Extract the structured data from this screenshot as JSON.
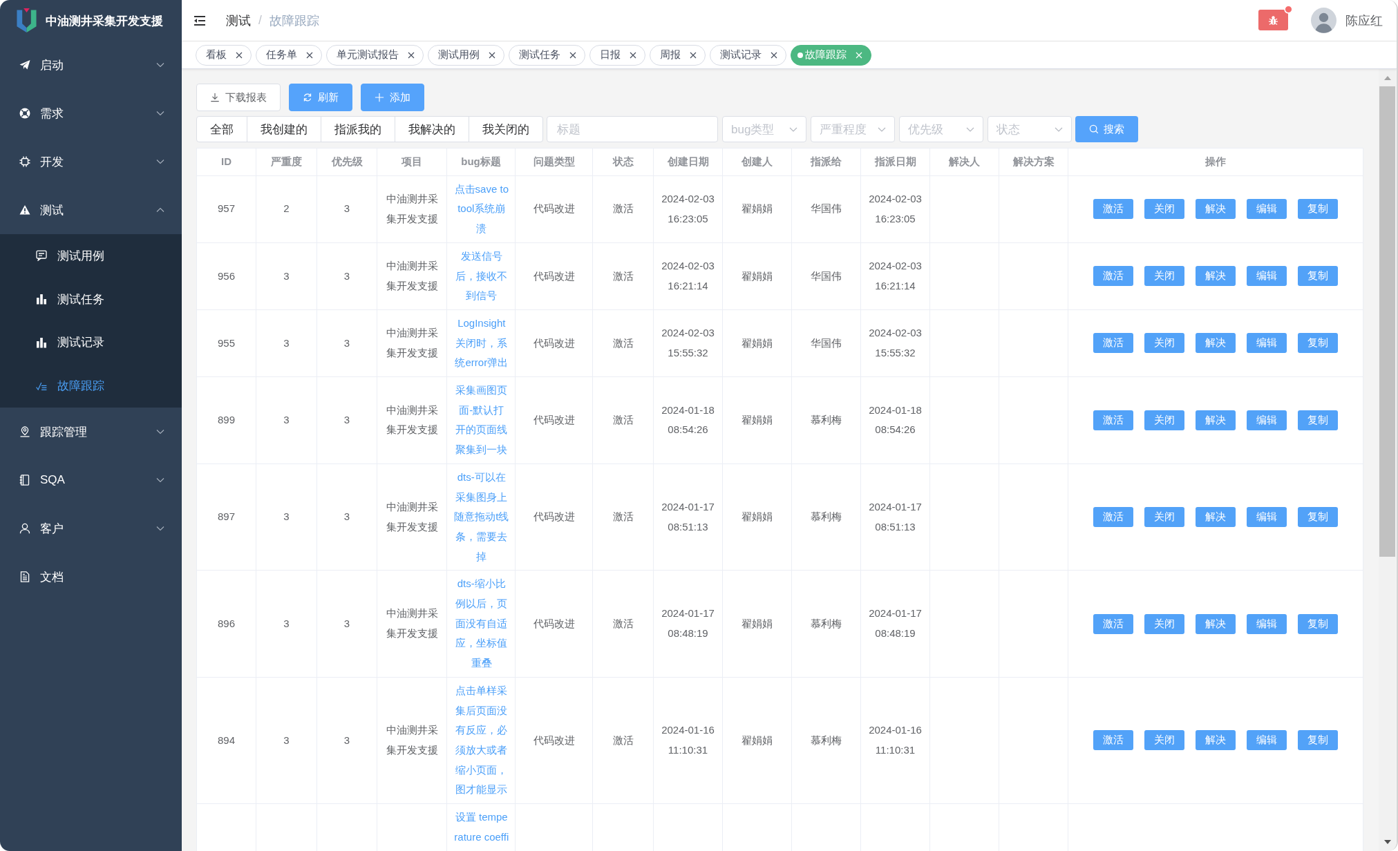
{
  "sidebar": {
    "title": "中油测井采集开发支援",
    "items": [
      {
        "label": "启动",
        "kind": "group",
        "expanded": false,
        "selected": false
      },
      {
        "label": "需求",
        "kind": "group",
        "expanded": false,
        "selected": false
      },
      {
        "label": "开发",
        "kind": "group",
        "expanded": false,
        "selected": false
      },
      {
        "label": "测试",
        "kind": "group",
        "expanded": true,
        "selected": false,
        "children": [
          {
            "label": "测试用例",
            "selected": false
          },
          {
            "label": "测试任务",
            "selected": false
          },
          {
            "label": "测试记录",
            "selected": false
          },
          {
            "label": "故障跟踪",
            "selected": true
          }
        ]
      },
      {
        "label": "跟踪管理",
        "kind": "group",
        "expanded": false,
        "selected": false
      },
      {
        "label": "SQA",
        "kind": "group",
        "expanded": false,
        "selected": false
      },
      {
        "label": "客户",
        "kind": "group",
        "expanded": false,
        "selected": false
      },
      {
        "label": "文档",
        "kind": "link",
        "selected": false
      }
    ]
  },
  "header": {
    "breadcrumb": {
      "separator": "/",
      "items": [
        {
          "label": "测试",
          "current": false
        },
        {
          "label": "故障跟踪",
          "current": true
        }
      ]
    },
    "bug_button": {
      "notification": true
    },
    "user": {
      "name": "陈应红"
    }
  },
  "tags": [
    {
      "label": "看板",
      "selected": false
    },
    {
      "label": "任务单",
      "selected": false
    },
    {
      "label": "单元测试报告",
      "selected": false
    },
    {
      "label": "测试用例",
      "selected": false
    },
    {
      "label": "测试任务",
      "selected": false
    },
    {
      "label": "日报",
      "selected": false
    },
    {
      "label": "周报",
      "selected": false
    },
    {
      "label": "测试记录",
      "selected": false
    },
    {
      "label": "故障跟踪",
      "selected": true
    }
  ],
  "toolbar": {
    "actions": [
      {
        "label": "下载报表",
        "kind": "default"
      },
      {
        "label": "刷新",
        "kind": "primary"
      },
      {
        "label": "添加",
        "kind": "primary"
      }
    ]
  },
  "filters": {
    "scopes": [
      {
        "label": "全部",
        "selected": false
      },
      {
        "label": "我创建的",
        "selected": false
      },
      {
        "label": "指派我的",
        "selected": false
      },
      {
        "label": "我解决的",
        "selected": false
      },
      {
        "label": "我关闭的",
        "selected": false
      }
    ],
    "title_field": {
      "placeholder": "标题"
    },
    "selects": [
      {
        "placeholder": "bug类型"
      },
      {
        "placeholder": "严重程度"
      },
      {
        "placeholder": "优先级"
      },
      {
        "placeholder": "状态"
      }
    ],
    "search_button": {
      "label": "搜索"
    }
  },
  "table": {
    "columns": [
      "ID",
      "严重度",
      "优先级",
      "项目",
      "bug标题",
      "问题类型",
      "状态",
      "创建日期",
      "创建人",
      "指派给",
      "指派日期",
      "解决人",
      "解决方案",
      "操作"
    ],
    "rows": [
      {
        "id": "957",
        "severity": "2",
        "priority": "3",
        "project": "中油测井采集开发支援",
        "title": "点击save to tool系统崩溃",
        "type": "代码改进",
        "status": "激活",
        "created": "2024-02-03 16:23:05",
        "creator": "翟娟娟",
        "assignee": "华国伟",
        "assigned": "2024-02-03 16:23:05",
        "actions": [
          "激活",
          "关闭",
          "解决",
          "编辑",
          "复制"
        ]
      },
      {
        "id": "956",
        "severity": "3",
        "priority": "3",
        "project": "中油测井采集开发支援",
        "title": "发送信号后，接收不到信号",
        "type": "代码改进",
        "status": "激活",
        "created": "2024-02-03 16:21:14",
        "creator": "翟娟娟",
        "assignee": "华国伟",
        "assigned": "2024-02-03 16:21:14",
        "actions": [
          "激活",
          "关闭",
          "解决",
          "编辑",
          "复制"
        ]
      },
      {
        "id": "955",
        "severity": "3",
        "priority": "3",
        "project": "中油测井采集开发支援",
        "title": "LogInsight关闭时，系统error弹出",
        "type": "代码改进",
        "status": "激活",
        "created": "2024-02-03 15:55:32",
        "creator": "翟娟娟",
        "assignee": "华国伟",
        "assigned": "2024-02-03 15:55:32",
        "actions": [
          "激活",
          "关闭",
          "解决",
          "编辑",
          "复制"
        ]
      },
      {
        "id": "899",
        "severity": "3",
        "priority": "3",
        "project": "中油测井采集开发支援",
        "title": "采集画图页面-默认打开的页面线聚集到一块",
        "type": "代码改进",
        "status": "激活",
        "created": "2024-01-18 08:54:26",
        "creator": "翟娟娟",
        "assignee": "慕利梅",
        "assigned": "2024-01-18 08:54:26",
        "actions": [
          "激活",
          "关闭",
          "解决",
          "编辑",
          "复制"
        ]
      },
      {
        "id": "897",
        "severity": "3",
        "priority": "3",
        "project": "中油测井采集开发支援",
        "title": "dts-可以在采集图身上随意拖动t线条，需要去掉",
        "type": "代码改进",
        "status": "激活",
        "created": "2024-01-17 08:51:13",
        "creator": "翟娟娟",
        "assignee": "慕利梅",
        "assigned": "2024-01-17 08:51:13",
        "actions": [
          "激活",
          "关闭",
          "解决",
          "编辑",
          "复制"
        ]
      },
      {
        "id": "896",
        "severity": "3",
        "priority": "3",
        "project": "中油测井采集开发支援",
        "title": "dts-缩小比例以后，页面没有自适应，坐标值重叠",
        "type": "代码改进",
        "status": "激活",
        "created": "2024-01-17 08:48:19",
        "creator": "翟娟娟",
        "assignee": "慕利梅",
        "assigned": "2024-01-17 08:48:19",
        "actions": [
          "激活",
          "关闭",
          "解决",
          "编辑",
          "复制"
        ]
      },
      {
        "id": "894",
        "severity": "3",
        "priority": "3",
        "project": "中油测井采集开发支援",
        "title": "点击单样采集后页面没有反应，必须放大或者缩小页面，图才能显示",
        "type": "代码改进",
        "status": "激活",
        "created": "2024-01-16 11:10:31",
        "creator": "翟娟娟",
        "assignee": "慕利梅",
        "assigned": "2024-01-16 11:10:31",
        "actions": [
          "激活",
          "关闭",
          "解决",
          "编辑",
          "复制"
        ]
      },
      {
        "title": "设置 temperature coeffi"
      }
    ]
  }
}
